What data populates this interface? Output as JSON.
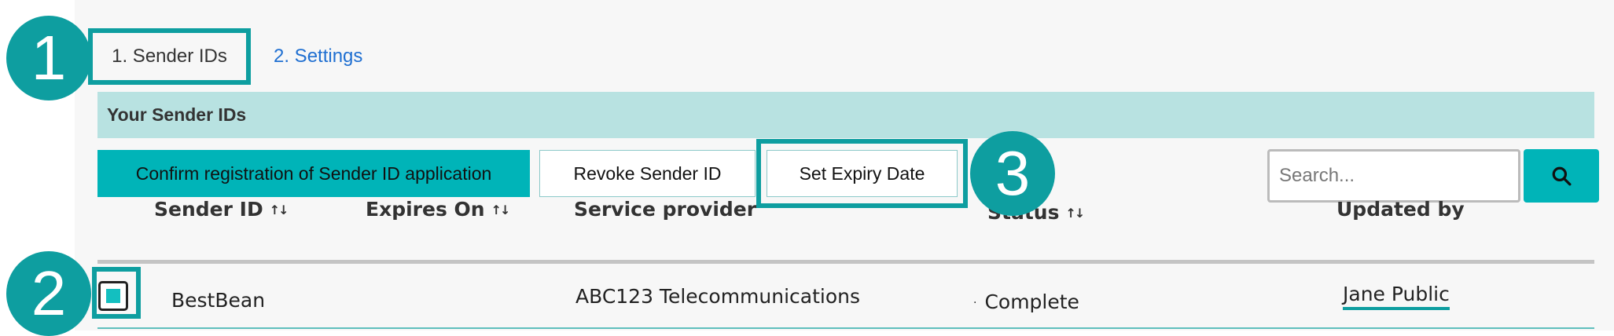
{
  "tabs": [
    {
      "label": "1. Sender IDs",
      "active": true
    },
    {
      "label": "2. Settings",
      "active": false
    }
  ],
  "header": {
    "title": "Your Sender IDs"
  },
  "toolbar": {
    "confirm_label": "Confirm registration of Sender ID application",
    "revoke_label": "Revoke Sender ID",
    "expiry_label": "Set Expiry Date"
  },
  "search": {
    "placeholder": "Search...",
    "value": ""
  },
  "columns": {
    "sender_id": "Sender ID",
    "expires_on": "Expires On",
    "service_provider": "Service provider",
    "status": "Status",
    "updated_by": "Updated by",
    "sort_glyph": "↑↓"
  },
  "rows": [
    {
      "selected": true,
      "sender_id": "BestBean",
      "expires_on": "",
      "service_provider": "ABC123 Telecommunications",
      "status": "Complete",
      "updated_by": "Jane Public"
    }
  ],
  "callouts": [
    "1",
    "2",
    "3"
  ],
  "colors": {
    "accent": "#00b4b8",
    "highlight": "#0e9ea0",
    "header_bg": "#b8e2e1",
    "link": "#1f6fd1"
  },
  "icons": {
    "search": "search-icon",
    "sort": "sort-icon"
  }
}
